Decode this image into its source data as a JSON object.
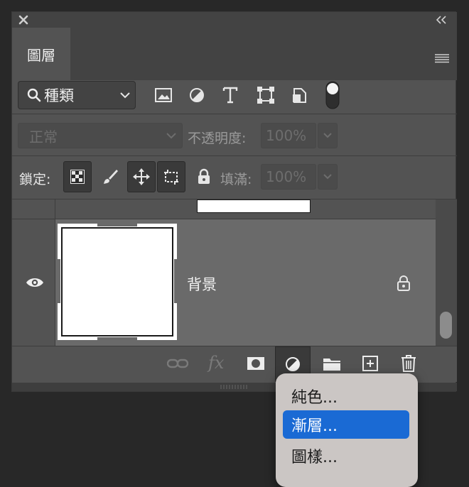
{
  "panel": {
    "tab_label": "圖層"
  },
  "filter": {
    "kind_label": "種類"
  },
  "blend": {
    "mode": "正常",
    "opacity_label": "不透明度:",
    "opacity_value": "100%"
  },
  "lock": {
    "label": "鎖定:",
    "fill_label": "填滿:",
    "fill_value": "100%"
  },
  "layers": [
    {
      "name": "背景",
      "visible": true,
      "locked": true
    }
  ],
  "bottom_bar": {
    "fx_label": "fx"
  },
  "context_menu": {
    "items": [
      {
        "label": "純色...",
        "active": false
      },
      {
        "label": "漸層...",
        "active": true
      },
      {
        "label": "圖樣...",
        "active": false
      }
    ]
  }
}
